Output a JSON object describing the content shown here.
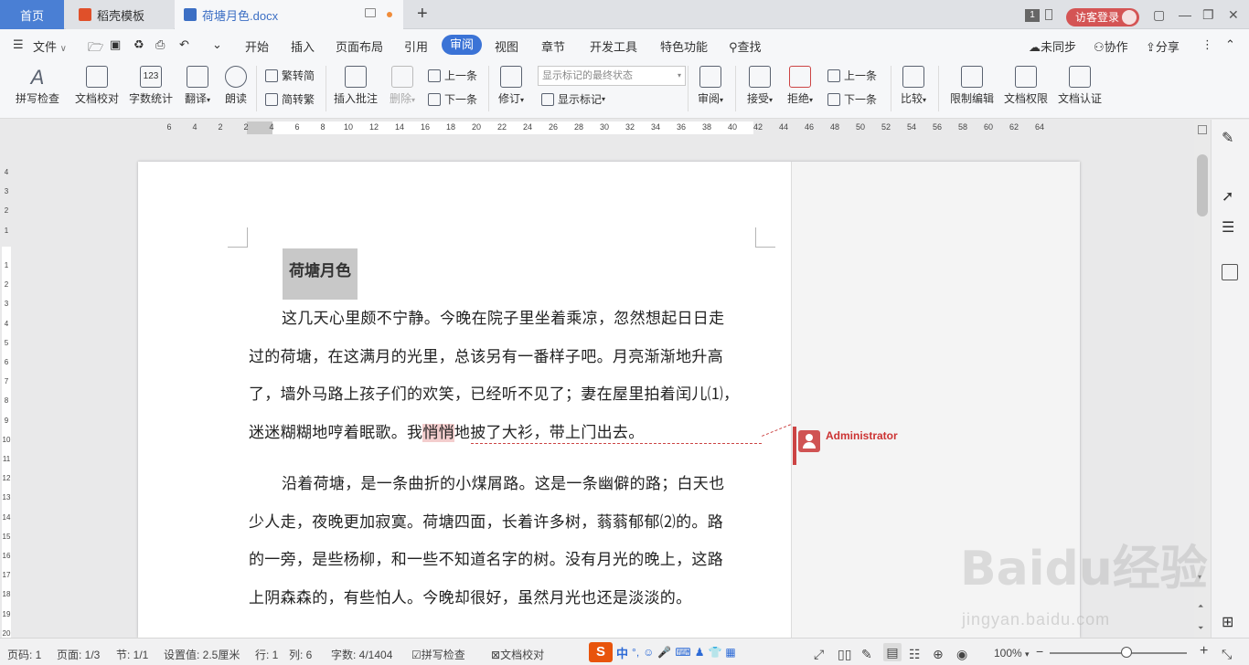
{
  "titlebar": {
    "home_tab": "首页",
    "daoke_tab": "稻壳模板",
    "doc_tab": "荷塘月色.docx",
    "add_tab": "+",
    "window_count": "1",
    "login_button": "访客登录"
  },
  "menubar": {
    "file": "文件",
    "items": [
      "开始",
      "插入",
      "页面布局",
      "引用",
      "审阅",
      "视图",
      "章节",
      "开发工具",
      "特色功能"
    ],
    "active": "审阅",
    "search": "查找",
    "sync": "未同步",
    "collab": "协作",
    "share": "分享"
  },
  "ribbon": {
    "spell_check": "拼写检查",
    "doc_proofread": "文档校对",
    "word_count": "字数统计",
    "translate": "翻译",
    "read_aloud": "朗读",
    "trad_to_simp": "繁转简",
    "simp_to_trad": "简转繁",
    "insert_comment": "插入批注",
    "delete": "删除",
    "prev": "上一条",
    "next": "下一条",
    "revise": "修订",
    "markup_state": "显示标记的最终状态",
    "show_markup": "显示标记",
    "review": "审阅",
    "accept": "接受",
    "reject": "拒绝",
    "prev2": "上一条",
    "next2": "下一条",
    "compare": "比较",
    "restrict_edit": "限制编辑",
    "doc_rights": "文档权限",
    "doc_cert": "文档认证"
  },
  "ruler": {
    "h_ticks": [
      "6",
      "4",
      "2",
      "2",
      "4",
      "6",
      "8",
      "10",
      "12",
      "14",
      "16",
      "18",
      "20",
      "22",
      "24",
      "26",
      "28",
      "30",
      "32",
      "34",
      "36",
      "38",
      "40",
      "42",
      "44",
      "46",
      "48",
      "50",
      "52",
      "54",
      "56",
      "58",
      "60",
      "62",
      "64"
    ],
    "v_ticks": [
      "4",
      "3",
      "2",
      "1",
      "1",
      "2",
      "3",
      "4",
      "5",
      "6",
      "7",
      "8",
      "9",
      "10",
      "11",
      "12",
      "13",
      "14",
      "15",
      "16",
      "17",
      "18",
      "19",
      "20"
    ]
  },
  "document": {
    "title": "荷塘月色",
    "p1_l1": "这几天心里颇不宁静。今晚在院子里坐着乘凉，忽然想起日日走",
    "p1_l2": "过的荷塘，在这满月的光里，总该另有一番样子吧。月亮渐渐地升高",
    "p1_l3": "了，墙外马路上孩子们的欢笑，已经听不见了；妻在屋里拍着闰儿⑴，",
    "p1_l4_a": "迷迷糊糊地哼着眠歌。我",
    "p1_l4_hl": "悄悄",
    "p1_l4_b": "地披了大衫，带上门出去。",
    "p2_l1": "沿着荷塘，是一条曲折的小煤屑路。这是一条幽僻的路；白天也",
    "p2_l2": "少人走，夜晚更加寂寞。荷塘四面，长着许多树，蓊蓊郁郁⑵的。路",
    "p2_l3": "的一旁，是些杨柳，和一些不知道名字的树。没有月光的晚上，这路",
    "p2_l4": "上阴森森的，有些怕人。今晚却很好，虽然月光也还是淡淡的。"
  },
  "comment": {
    "author": "Administrator"
  },
  "statusbar": {
    "page_no": "页码: 1",
    "page": "页面: 1/3",
    "section": "节: 1/1",
    "setting": "设置值: 2.5厘米",
    "row": "行: 1",
    "col": "列: 6",
    "word_count": "字数: 4/1404",
    "spell_check": "拼写检查",
    "doc_proofread": "文档校对",
    "ime_logo": "S",
    "ime_lang": "中",
    "zoom": "100%"
  },
  "watermark": {
    "main": "Baidu经验",
    "sub": "jingyan.baidu.com"
  },
  "colors": {
    "accent": "#3b73d6",
    "home_tab": "#4a7fd4",
    "comment_red": "#cc3333",
    "highlight": "#f3cdcd"
  }
}
